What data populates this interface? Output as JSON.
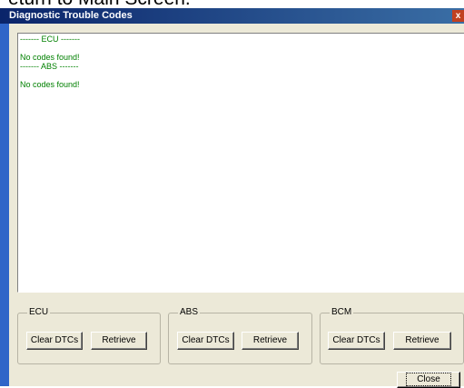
{
  "background_text": "eturn to Main Screen.",
  "window": {
    "title": "Diagnostic Trouble Codes",
    "close_glyph": "x"
  },
  "log": {
    "lines": [
      "------- ECU -------",
      "",
      "No codes found!",
      "------- ABS -------",
      "",
      "No codes found!"
    ],
    "text_color": "#008000"
  },
  "groups": [
    {
      "label": "ECU",
      "clear_label": "Clear DTCs",
      "retrieve_label": "Retrieve"
    },
    {
      "label": "ABS",
      "clear_label": "Clear DTCs",
      "retrieve_label": "Retrieve"
    },
    {
      "label": "BCM",
      "clear_label": "Clear DTCs",
      "retrieve_label": "Retrieve"
    }
  ],
  "close_button": {
    "label": "Close"
  }
}
